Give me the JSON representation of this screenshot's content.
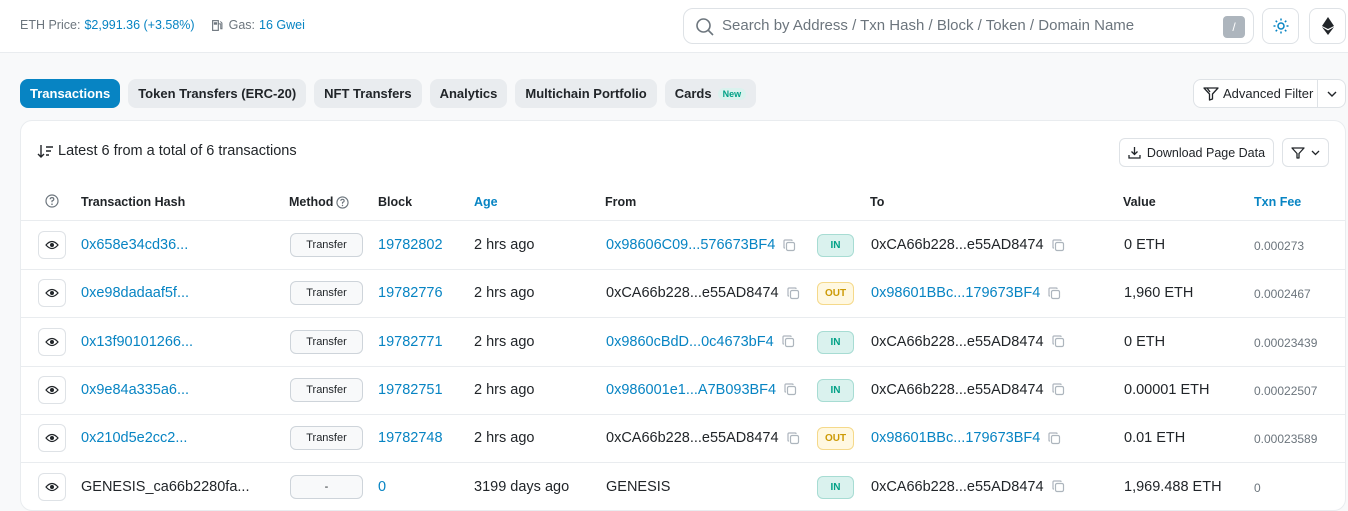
{
  "header": {
    "eth_price_label": "ETH Price:",
    "eth_price_value": "$2,991.36 (+3.58%)",
    "gas_label": "Gas:",
    "gas_value": "16 Gwei",
    "search_placeholder": "Search by Address / Txn Hash / Block / Token / Domain Name",
    "search_shortcut": "/"
  },
  "tabs": [
    {
      "label": "Transactions",
      "active": true
    },
    {
      "label": "Token Transfers (ERC-20)"
    },
    {
      "label": "NFT Transfers"
    },
    {
      "label": "Analytics"
    },
    {
      "label": "Multichain Portfolio"
    },
    {
      "label": "Cards",
      "badge": "New"
    }
  ],
  "advanced_filter_label": "Advanced Filter",
  "summary": "Latest 6 from a total of 6 transactions",
  "download_label": "Download Page Data",
  "columns": {
    "hash": "Transaction Hash",
    "method": "Method",
    "block": "Block",
    "age": "Age",
    "from": "From",
    "to": "To",
    "value": "Value",
    "fee": "Txn Fee"
  },
  "rows": [
    {
      "hash": "0x658e34cd36...",
      "method": "Transfer",
      "block": "19782802",
      "age": "2 hrs ago",
      "from": "0x98606C09...576673BF4",
      "from_link": true,
      "dir": "IN",
      "to": "0xCA66b228...e55AD8474",
      "to_link": false,
      "value": "0 ETH",
      "fee": "0.000273"
    },
    {
      "hash": "0xe98dadaaf5f...",
      "method": "Transfer",
      "block": "19782776",
      "age": "2 hrs ago",
      "from": "0xCA66b228...e55AD8474",
      "from_link": false,
      "dir": "OUT",
      "to": "0x98601BBc...179673BF4",
      "to_link": true,
      "value": "1,960 ETH",
      "fee": "0.0002467"
    },
    {
      "hash": "0x13f90101266...",
      "method": "Transfer",
      "block": "19782771",
      "age": "2 hrs ago",
      "from": "0x9860cBdD...0c4673bF4",
      "from_link": true,
      "dir": "IN",
      "to": "0xCA66b228...e55AD8474",
      "to_link": false,
      "value": "0 ETH",
      "fee": "0.00023439"
    },
    {
      "hash": "0x9e84a335a6...",
      "method": "Transfer",
      "block": "19782751",
      "age": "2 hrs ago",
      "from": "0x986001e1...A7B093BF4",
      "from_link": true,
      "dir": "IN",
      "to": "0xCA66b228...e55AD8474",
      "to_link": false,
      "value": "0.00001 ETH",
      "fee": "0.00022507"
    },
    {
      "hash": "0x210d5e2cc2...",
      "method": "Transfer",
      "block": "19782748",
      "age": "2 hrs ago",
      "from": "0xCA66b228...e55AD8474",
      "from_link": false,
      "dir": "OUT",
      "to": "0x98601BBc...179673BF4",
      "to_link": true,
      "value": "0.01 ETH",
      "fee": "0.00023589"
    },
    {
      "hash": "GENESIS_ca66b2280fa...",
      "hash_link": false,
      "method": "-",
      "block": "0",
      "age": "3199 days ago",
      "from": "GENESIS",
      "from_link": false,
      "from_copy": false,
      "dir": "IN",
      "to": "0xCA66b228...e55AD8474",
      "to_link": false,
      "value": "1,969.488 ETH",
      "fee": "0"
    }
  ]
}
